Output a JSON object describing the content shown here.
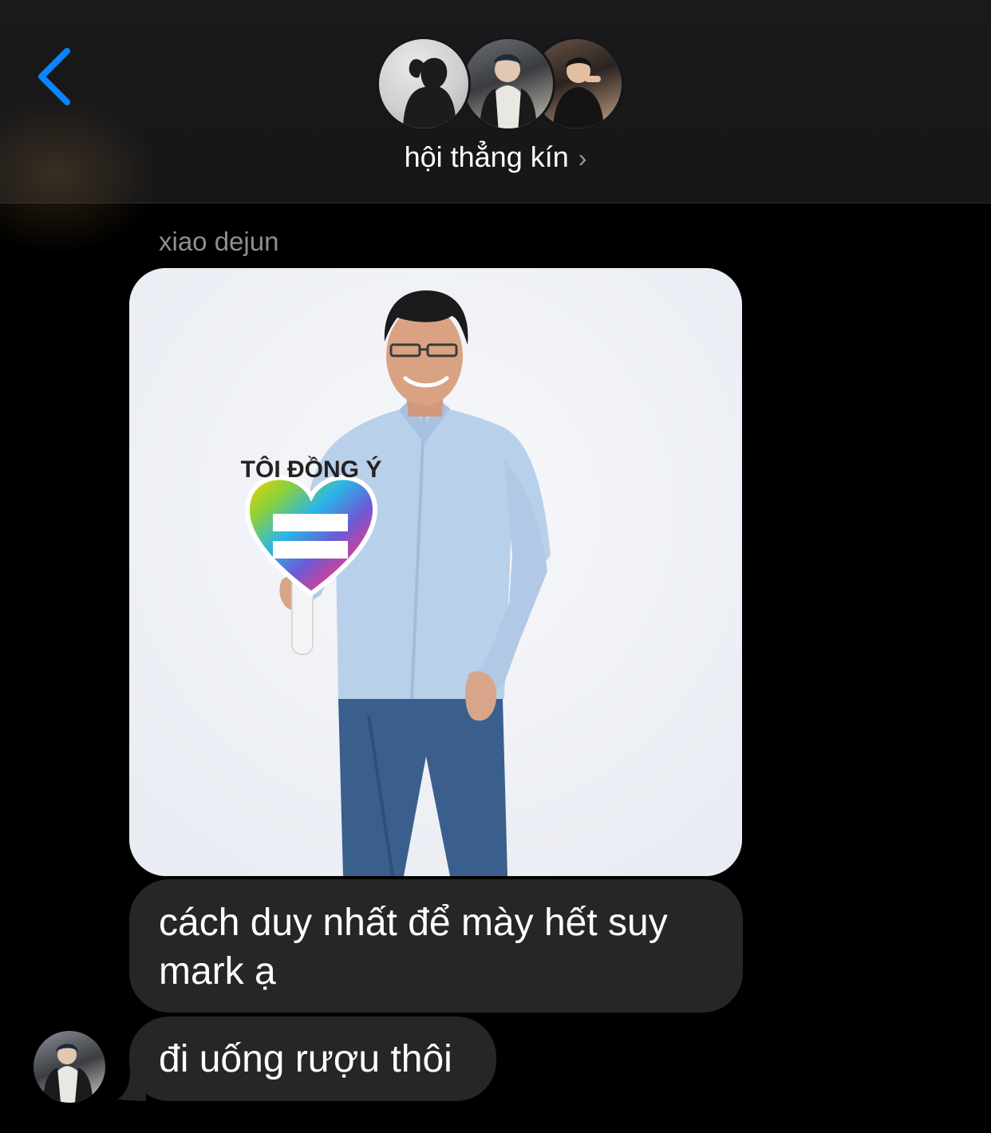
{
  "header": {
    "group_name": "hội thẳng kín",
    "chevron": "›",
    "back_icon": "chevron-left-icon",
    "accent_color": "#0a84ff"
  },
  "messages": [
    {
      "sender": "xiao dejun",
      "type": "image",
      "image_sign_text": "TÔI ĐỒNG Ý"
    },
    {
      "type": "text",
      "text": "cách duy nhất để mày hết suy mark ạ"
    },
    {
      "type": "text",
      "text": "đi uống rượu thôi"
    }
  ]
}
